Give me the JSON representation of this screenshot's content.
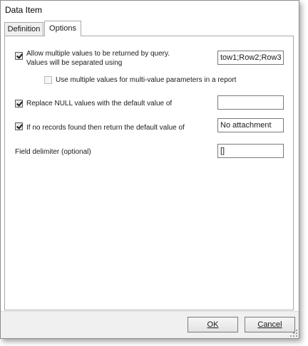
{
  "window": {
    "title": "Data Item"
  },
  "tabs": [
    {
      "label": "Definition",
      "selected": false
    },
    {
      "label": "Options",
      "selected": true
    }
  ],
  "options": {
    "allow_multiple": {
      "checked": true,
      "label_line1": "Allow multiple values to be returned by query.",
      "label_line2": "Values will be separated using",
      "value": "tow1;Row2;Row3"
    },
    "use_multi_value": {
      "checked": false,
      "label": "Use multiple values for multi-value parameters in a report"
    },
    "replace_null": {
      "checked": true,
      "label": "Replace NULL values with the default value of",
      "value": ""
    },
    "no_records": {
      "checked": true,
      "label": "If no records found then return the default value of",
      "value": "No attachment"
    },
    "field_delimiter": {
      "label": "Field delimiter (optional)",
      "value": "[]"
    }
  },
  "buttons": {
    "ok": "OK",
    "cancel": "Cancel"
  }
}
